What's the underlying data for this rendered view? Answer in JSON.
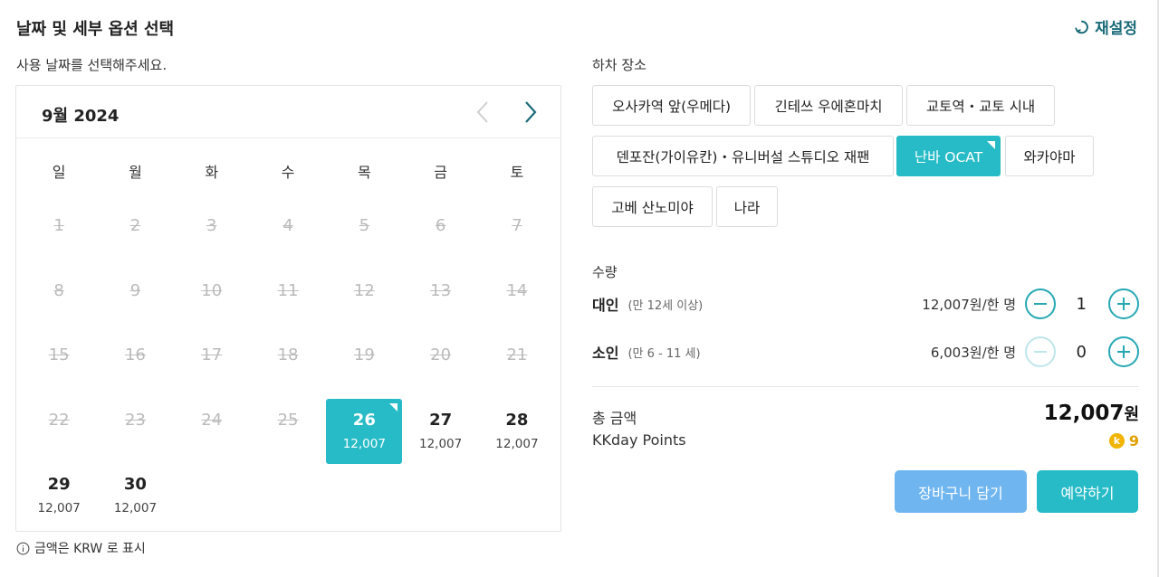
{
  "header": {
    "title": "날짜 및 세부 옵션 선택",
    "reset_label": "재설정"
  },
  "calendar": {
    "subtitle": "사용 날짜를 선택해주세요.",
    "month_label": "9월 2024",
    "weekdays": [
      "일",
      "월",
      "화",
      "수",
      "목",
      "금",
      "토"
    ],
    "days": [
      {
        "num": "1",
        "price": "",
        "state": "disabled"
      },
      {
        "num": "2",
        "price": "",
        "state": "disabled"
      },
      {
        "num": "3",
        "price": "",
        "state": "disabled"
      },
      {
        "num": "4",
        "price": "",
        "state": "disabled"
      },
      {
        "num": "5",
        "price": "",
        "state": "disabled"
      },
      {
        "num": "6",
        "price": "",
        "state": "disabled"
      },
      {
        "num": "7",
        "price": "",
        "state": "disabled"
      },
      {
        "num": "8",
        "price": "",
        "state": "disabled"
      },
      {
        "num": "9",
        "price": "",
        "state": "disabled"
      },
      {
        "num": "10",
        "price": "",
        "state": "disabled"
      },
      {
        "num": "11",
        "price": "",
        "state": "disabled"
      },
      {
        "num": "12",
        "price": "",
        "state": "disabled"
      },
      {
        "num": "13",
        "price": "",
        "state": "disabled"
      },
      {
        "num": "14",
        "price": "",
        "state": "disabled"
      },
      {
        "num": "15",
        "price": "",
        "state": "disabled"
      },
      {
        "num": "16",
        "price": "",
        "state": "disabled"
      },
      {
        "num": "17",
        "price": "",
        "state": "disabled"
      },
      {
        "num": "18",
        "price": "",
        "state": "disabled"
      },
      {
        "num": "19",
        "price": "",
        "state": "disabled"
      },
      {
        "num": "20",
        "price": "",
        "state": "disabled"
      },
      {
        "num": "21",
        "price": "",
        "state": "disabled"
      },
      {
        "num": "22",
        "price": "",
        "state": "disabled"
      },
      {
        "num": "23",
        "price": "",
        "state": "disabled"
      },
      {
        "num": "24",
        "price": "",
        "state": "disabled"
      },
      {
        "num": "25",
        "price": "",
        "state": "disabled"
      },
      {
        "num": "26",
        "price": "12,007",
        "state": "selected"
      },
      {
        "num": "27",
        "price": "12,007",
        "state": "available"
      },
      {
        "num": "28",
        "price": "12,007",
        "state": "available"
      },
      {
        "num": "29",
        "price": "12,007",
        "state": "available"
      },
      {
        "num": "30",
        "price": "12,007",
        "state": "available"
      }
    ],
    "currency_note": "금액은 KRW 로 표시"
  },
  "dropoff": {
    "label": "하차 장소",
    "options": [
      {
        "label": "오사카역 앞(우메다)",
        "selected": false
      },
      {
        "label": "긴테쓰 우에혼마치",
        "selected": false
      },
      {
        "label": "교토역・교토 시내",
        "selected": false
      },
      {
        "label": "덴포잔(가이유칸)・유니버설 스튜디오 재팬",
        "selected": false
      },
      {
        "label": "난바 OCAT",
        "selected": true
      },
      {
        "label": "와카야마",
        "selected": false
      },
      {
        "label": "고베 산노미야",
        "selected": false
      },
      {
        "label": "나라",
        "selected": false
      }
    ]
  },
  "quantity": {
    "label": "수량",
    "adult": {
      "label": "대인",
      "sub": "(만 12세 이상)",
      "price": "12,007원/한 명",
      "value": "1"
    },
    "child": {
      "label": "소인",
      "sub": "(만 6 - 11 세)",
      "price": "6,003원/한 명",
      "value": "0"
    }
  },
  "summary": {
    "total_label": "총 금액",
    "total_value": "12,007",
    "total_unit": "원",
    "points_label": "KKday Points",
    "points_value": "9",
    "coin_letter": "k"
  },
  "actions": {
    "cart_label": "장바구니 담기",
    "book_label": "예약하기"
  },
  "colors": {
    "accent": "#26bbc6",
    "cart": "#6fb5f0",
    "reset": "#1a6a78",
    "points": "#e0a100"
  },
  "icons": {
    "reset": "refresh-icon",
    "prev": "chevron-left-icon",
    "next": "chevron-right-icon",
    "info": "info-icon",
    "minus": "minus-icon",
    "plus": "plus-icon",
    "coin": "kkday-coin-icon"
  }
}
